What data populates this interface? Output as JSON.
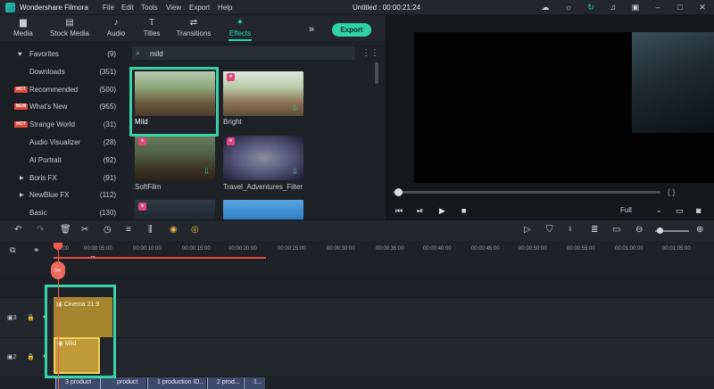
{
  "app": {
    "name": "Wondershare Filmora",
    "document_title": "Untitled : 00:00:21:24"
  },
  "menu": [
    "File",
    "Edit",
    "Tools",
    "View",
    "Export",
    "Help"
  ],
  "titlebar_icons": [
    "cloud-icon",
    "lightbulb-icon",
    "headset-icon",
    "bell-icon",
    "save-icon",
    "minimize-icon",
    "maximize-icon",
    "close-icon"
  ],
  "tabs": [
    {
      "label": "Media",
      "icon": "folder-icon"
    },
    {
      "label": "Stock Media",
      "icon": "stock-media-icon"
    },
    {
      "label": "Audio",
      "icon": "music-icon"
    },
    {
      "label": "Titles",
      "icon": "titles-icon"
    },
    {
      "label": "Transitions",
      "icon": "transitions-icon"
    },
    {
      "label": "Effects",
      "icon": "effects-icon",
      "active": true
    }
  ],
  "export_label": "Export",
  "sidebar": {
    "items": [
      {
        "label": "Favorites",
        "count": "(9)",
        "icon": "heart-icon"
      },
      {
        "label": "Downloads",
        "count": "(351)"
      },
      {
        "label": "Recommended",
        "count": "(500)",
        "badge": "HOT"
      },
      {
        "label": "What's New",
        "count": "(955)",
        "badge": "NEW"
      },
      {
        "label": "Strange World",
        "count": "(31)",
        "badge": "HOT"
      },
      {
        "label": "Audio Visualizer",
        "count": "(28)"
      },
      {
        "label": "AI Portrait",
        "count": "(92)"
      },
      {
        "label": "Boris FX",
        "count": "(91)",
        "expandable": true
      },
      {
        "label": "NewBlue FX",
        "count": "(112)",
        "expandable": true
      },
      {
        "label": "Basic",
        "count": "(130)"
      }
    ]
  },
  "search": {
    "value": "mild"
  },
  "effects": [
    {
      "label": "Mild",
      "premium": false,
      "download": false
    },
    {
      "label": "Bright",
      "premium": true,
      "download": true
    },
    {
      "label": "SoftFilm",
      "premium": true,
      "download": true
    },
    {
      "label": "Travel_Adventures_Filter",
      "premium": true,
      "download": true
    },
    {
      "label": "",
      "premium": true,
      "download": false
    },
    {
      "label": "",
      "premium": false,
      "download": false
    }
  ],
  "preview": {
    "progress": 0.02,
    "quality": "Full",
    "brackets": "{   }"
  },
  "timeline": {
    "ruler_labels": [
      "00:00",
      "00:00:05:00",
      "00:00:10:00",
      "00:00:15:00",
      "00:00:20:00",
      "00:00:25:00",
      "00:00:30:00",
      "00:00:35:00",
      "00:00:40:00",
      "00:00:45:00",
      "00:00:50:00",
      "00:00:55:00",
      "00:01:00:00",
      "00:01:05:00"
    ],
    "tracks": [
      {
        "number": "3"
      },
      {
        "number": "2"
      }
    ],
    "clips": {
      "cinema": "Cinema 21:9",
      "mild": "Mild",
      "video": [
        "3 product",
        "product",
        "1 production ID...",
        "2 prod...",
        "1..."
      ]
    }
  },
  "colors": {
    "accent": "#2ed3a6",
    "highlight": "#39d2a6",
    "playhead": "#ef5b4e",
    "effect_clip": "#a5862f"
  }
}
